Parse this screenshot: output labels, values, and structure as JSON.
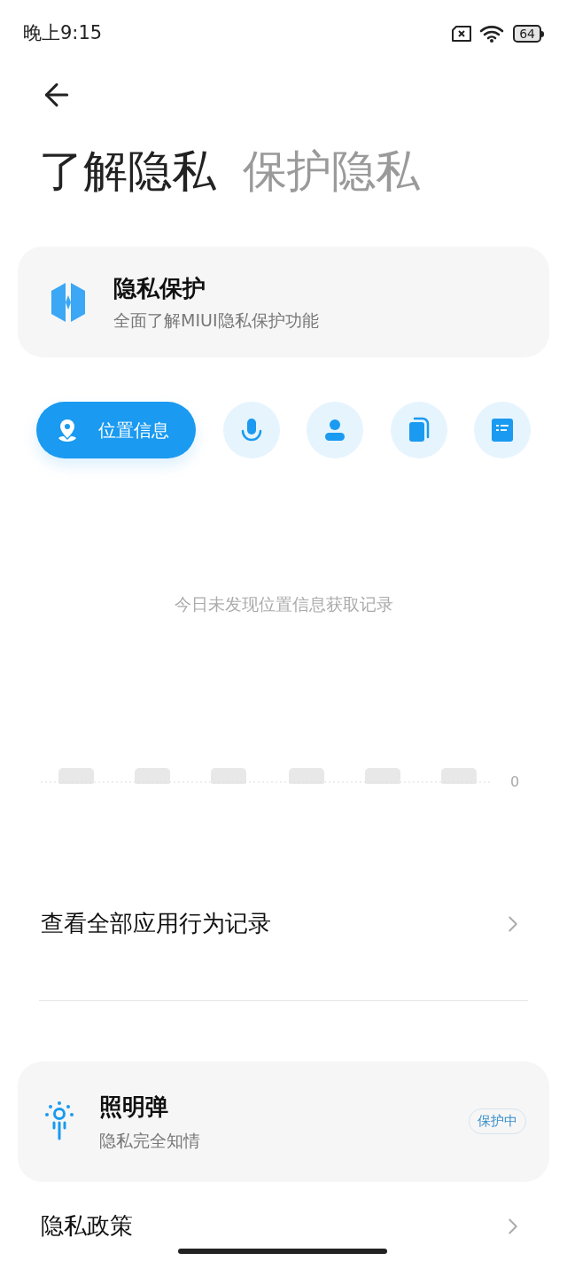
{
  "status_bar": {
    "time": "晚上9:15",
    "battery": "64"
  },
  "header_tabs": [
    {
      "label": "了解隐私",
      "selected": true
    },
    {
      "label": "保护隐私",
      "selected": false
    }
  ],
  "privacy_card": {
    "title": "隐私保护",
    "subtitle": "全面了解MIUI隐私保护功能"
  },
  "categories": [
    {
      "kind": "location",
      "label": "位置信息",
      "selected": true
    },
    {
      "kind": "microphone",
      "selected": false
    },
    {
      "kind": "contacts",
      "selected": false
    },
    {
      "kind": "clipboard",
      "selected": false
    },
    {
      "kind": "records",
      "selected": false
    }
  ],
  "empty_message": "今日未发现位置信息获取记录",
  "chart_axis_label": "0",
  "all_records_link": "查看全部应用行为记录",
  "flare_card": {
    "title": "照明弹",
    "subtitle": "隐私完全知情",
    "badge": "保护中"
  },
  "policy_link": "隐私政策"
}
